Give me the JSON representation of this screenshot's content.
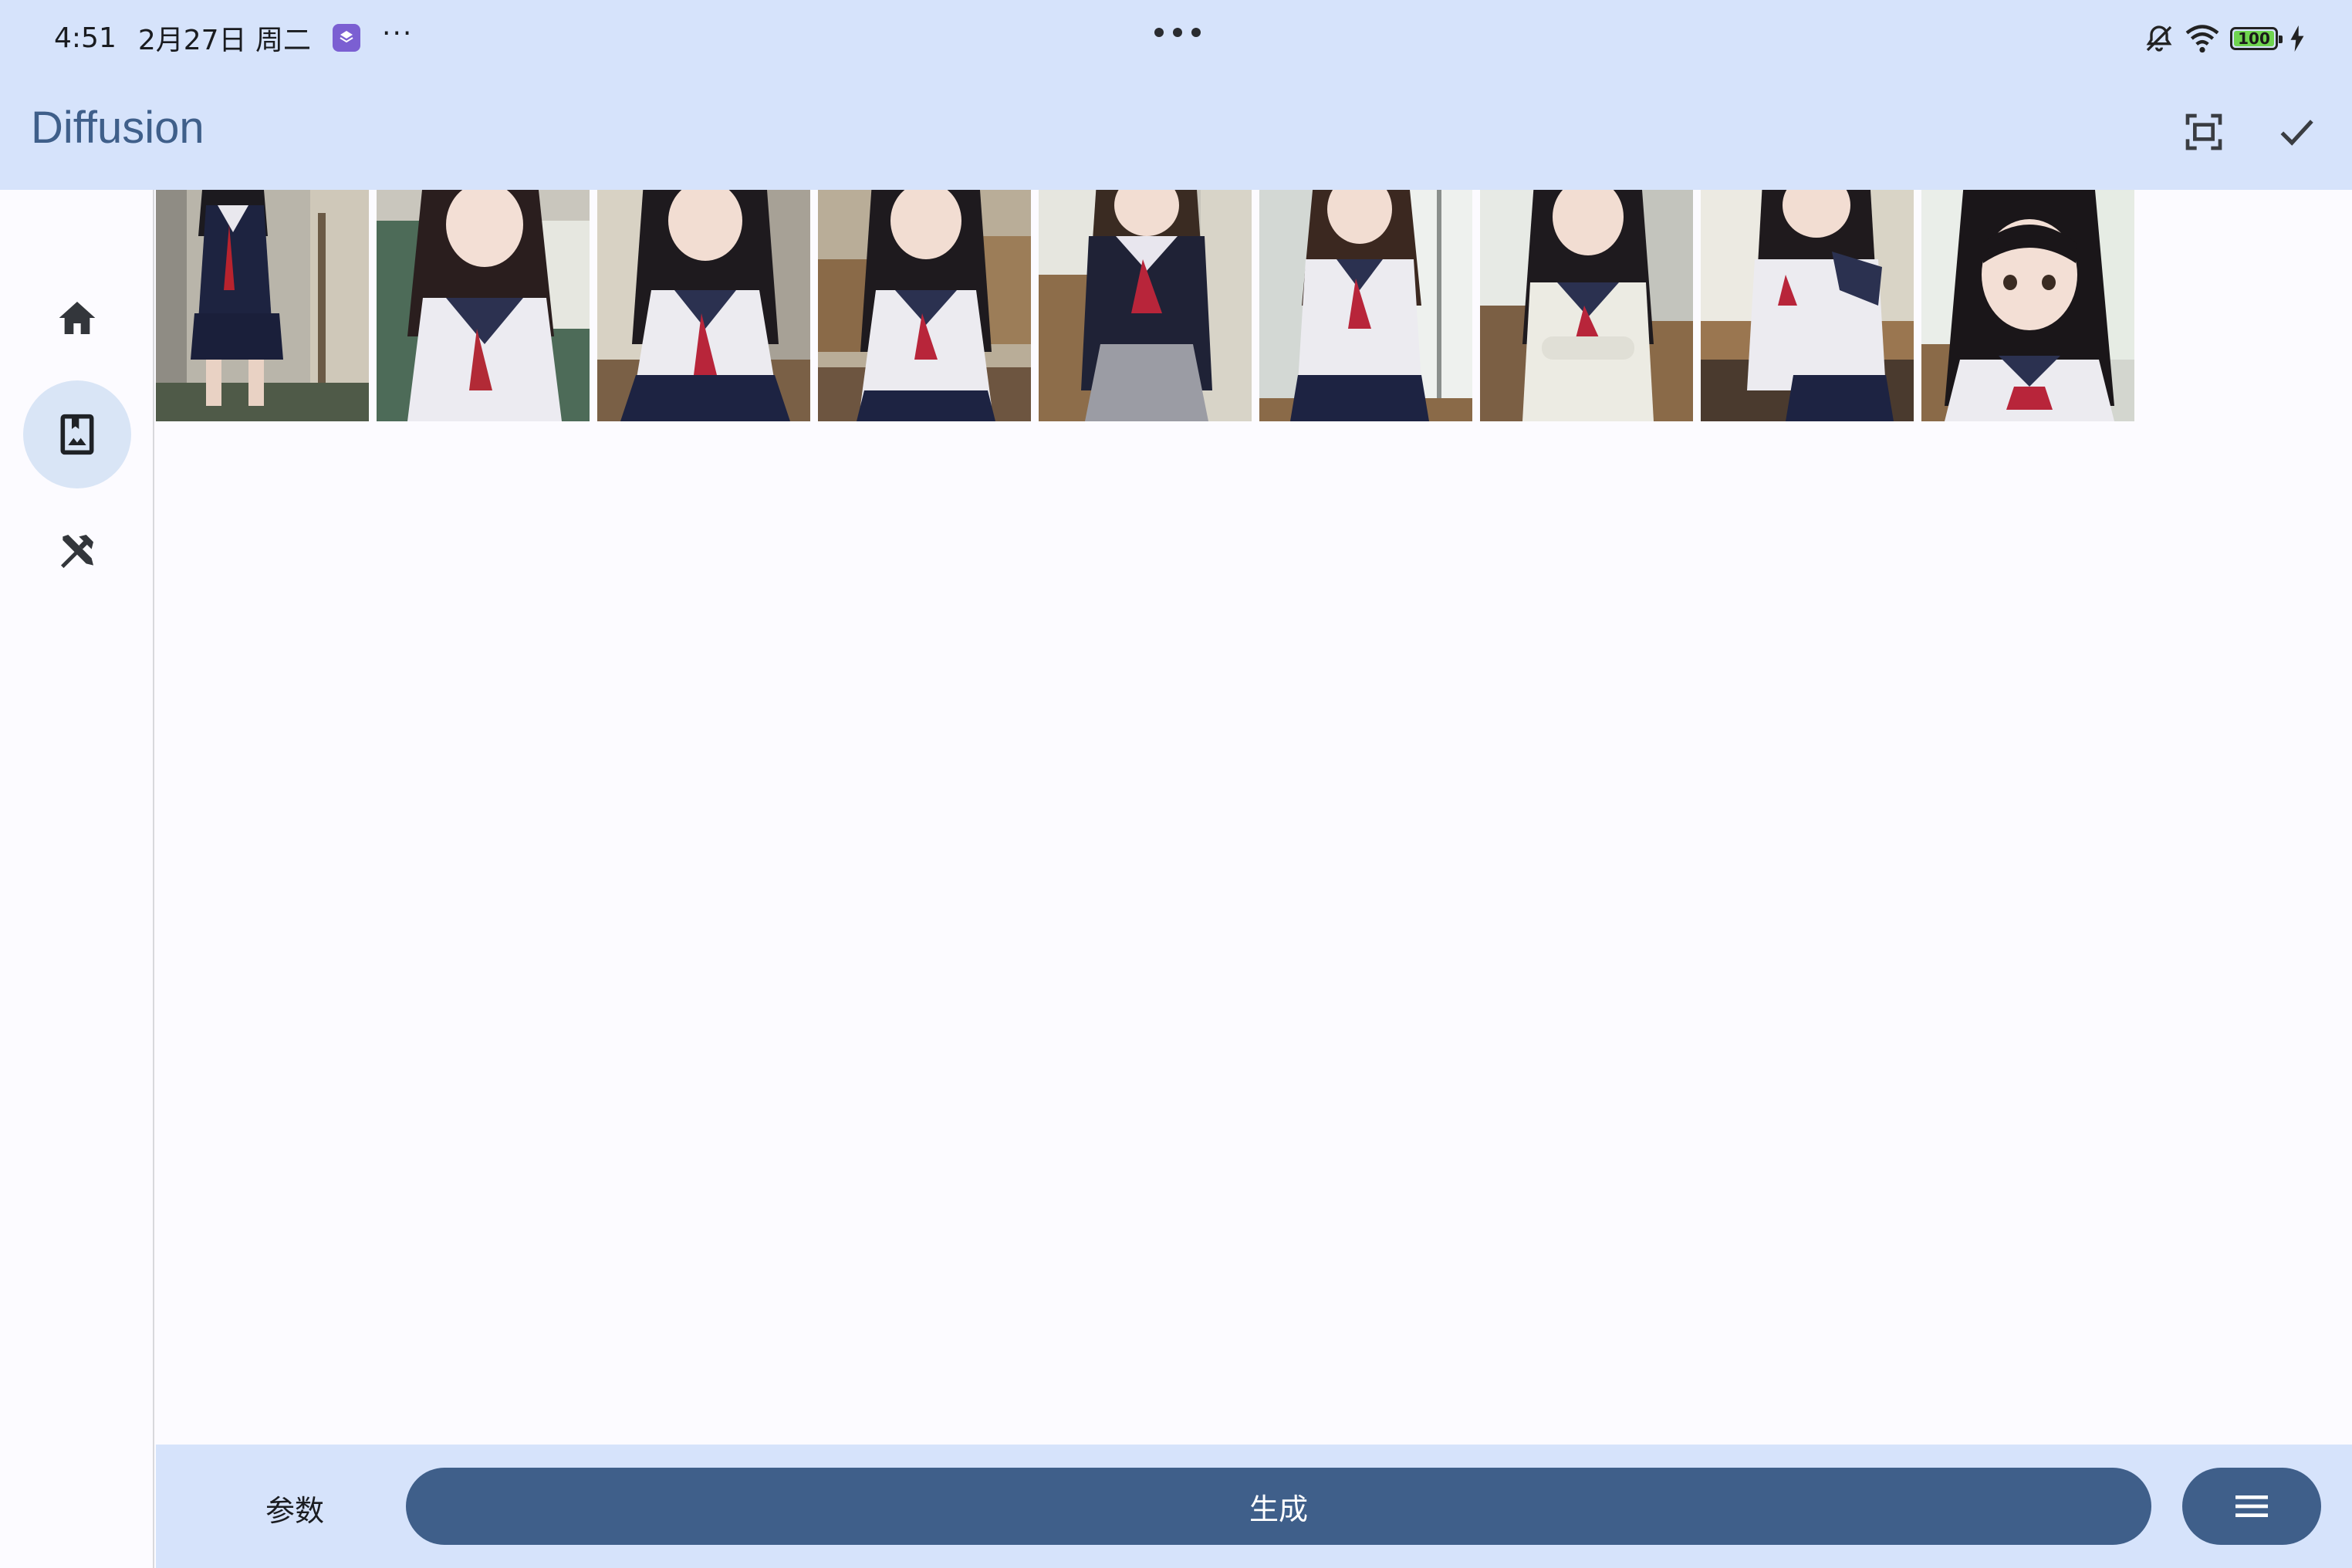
{
  "status_bar": {
    "time": "4:51",
    "date": "2月27日 周二",
    "battery_level": "100",
    "more": "···"
  },
  "app_bar": {
    "title": "Diffusion",
    "actions": [
      "fullscreen-icon",
      "check-icon"
    ]
  },
  "nav_rail": {
    "items": [
      {
        "icon": "home-icon",
        "selected": false
      },
      {
        "icon": "gallery-icon",
        "selected": true
      },
      {
        "icon": "tools-icon",
        "selected": false
      }
    ]
  },
  "gallery": {
    "image_count": 9
  },
  "bottom_bar": {
    "params_label": "参数",
    "generate_label": "生成",
    "menu_icon": "menu-icon"
  },
  "colors": {
    "bar_bg": "#d6e3fb",
    "primary": "#3f5f8a",
    "rail_selected": "#d9e5f6",
    "background": "#fcfbff"
  }
}
